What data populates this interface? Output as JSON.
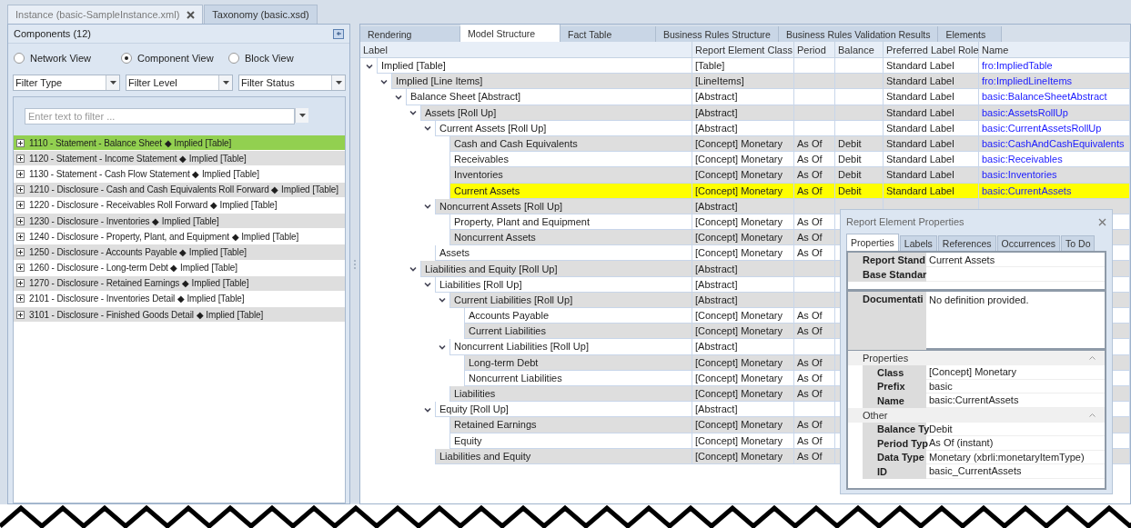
{
  "document_tabs": [
    {
      "label": "Instance (basic-SampleInstance.xml)",
      "selected": true,
      "closable": true
    },
    {
      "label": "Taxonomy (basic.xsd)",
      "selected": false,
      "closable": false
    }
  ],
  "components_panel": {
    "title": "Components (12)",
    "views": [
      {
        "label": "Network View",
        "selected": false
      },
      {
        "label": "Component View",
        "selected": true
      },
      {
        "label": "Block View",
        "selected": false
      }
    ],
    "filters": [
      {
        "value": "Filter Type"
      },
      {
        "value": "Filter Level"
      },
      {
        "value": "Filter Status"
      }
    ],
    "search": {
      "placeholder": "Enter text to filter ..."
    },
    "items": [
      {
        "label": "1110 - Statement - Balance Sheet ◆ Implied [Table]",
        "selected": true
      },
      {
        "label": "1120 - Statement - Income Statement ◆ Implied [Table]",
        "selected": false
      },
      {
        "label": "1130 - Statement - Cash Flow Statement ◆ Implied [Table]",
        "selected": false
      },
      {
        "label": "1210 - Disclosure - Cash and Cash Equivalents Roll Forward ◆ Implied [Table]",
        "selected": false
      },
      {
        "label": "1220 - Disclosure - Receivables Roll Forward ◆ Implied [Table]",
        "selected": false
      },
      {
        "label": "1230 - Disclosure - Inventories ◆ Implied [Table]",
        "selected": false
      },
      {
        "label": "1240 - Disclosure - Property, Plant, and Equipment ◆ Implied [Table]",
        "selected": false
      },
      {
        "label": "1250 - Disclosure - Accounts Payable ◆ Implied [Table]",
        "selected": false
      },
      {
        "label": "1260 - Disclosure - Long-term Debt ◆ Implied [Table]",
        "selected": false
      },
      {
        "label": "1270 - Disclosure - Retained Earnings ◆ Implied [Table]",
        "selected": false
      },
      {
        "label": "2101 - Disclosure - Inventories Detail ◆ Implied [Table]",
        "selected": false
      },
      {
        "label": "3101 - Disclosure - Finished Goods Detail ◆ Implied [Table]",
        "selected": false
      }
    ]
  },
  "view_tabs": [
    {
      "label": "Rendering",
      "selected": false
    },
    {
      "label": "Model Structure",
      "selected": true
    },
    {
      "label": "Fact Table",
      "selected": false
    },
    {
      "label": "Business Rules Structure",
      "selected": false
    },
    {
      "label": "Business Rules Validation Results",
      "selected": false
    },
    {
      "label": "Elements",
      "selected": false
    }
  ],
  "table": {
    "columns": [
      "Label",
      "Report Element Class",
      "Period",
      "Balance",
      "Preferred Label Role",
      "Name"
    ],
    "rows": [
      {
        "label": "Implied [Table]",
        "class": "[Table]",
        "role": "Standard Label",
        "name": "fro:ImpliedTable",
        "selected": false,
        "expanded": true,
        "children": [
          {
            "label": "Implied [Line Items]",
            "class": "[LineItems]",
            "role": "Standard Label",
            "name": "fro:ImpliedLineItems",
            "selected": false,
            "expanded": true,
            "children": [
              {
                "label": "Balance Sheet [Abstract]",
                "class": "[Abstract]",
                "role": "Standard Label",
                "name": "basic:BalanceSheetAbstract",
                "selected": false,
                "expanded": true,
                "children": [
                  {
                    "label": "Assets [Roll Up]",
                    "class": "[Abstract]",
                    "role": "Standard Label",
                    "name": "basic:AssetsRollUp",
                    "selected": false,
                    "expanded": true,
                    "children": [
                      {
                        "label": "Current Assets [Roll Up]",
                        "class": "[Abstract]",
                        "role": "Standard Label",
                        "name": "basic:CurrentAssetsRollUp",
                        "selected": false,
                        "expanded": true,
                        "children": [
                          {
                            "label": "Cash and Cash Equivalents",
                            "class": "[Concept] Monetary",
                            "period": "As Of",
                            "balance": "Debit",
                            "role": "Standard Label",
                            "name": "basic:CashAndCashEquivalents",
                            "selected": false
                          },
                          {
                            "label": "Receivables",
                            "class": "[Concept] Monetary",
                            "period": "As Of",
                            "balance": "Debit",
                            "role": "Standard Label",
                            "name": "basic:Receivables",
                            "selected": false
                          },
                          {
                            "label": "Inventories",
                            "class": "[Concept] Monetary",
                            "period": "As Of",
                            "balance": "Debit",
                            "role": "Standard Label",
                            "name": "basic:Inventories",
                            "selected": false
                          },
                          {
                            "label": "Current Assets",
                            "class": "[Concept] Monetary",
                            "period": "As Of",
                            "balance": "Debit",
                            "role": "Standard Label",
                            "name": "basic:CurrentAssets",
                            "selected": true
                          }
                        ]
                      },
                      {
                        "label": "Noncurrent Assets [Roll Up]",
                        "class": "[Abstract]",
                        "selected": false,
                        "expanded": true,
                        "children": [
                          {
                            "label": "Property, Plant and Equipment",
                            "class": "[Concept] Monetary",
                            "period": "As Of",
                            "selected": false
                          },
                          {
                            "label": "Noncurrent Assets",
                            "class": "[Concept] Monetary",
                            "period": "As Of",
                            "selected": false
                          }
                        ]
                      },
                      {
                        "label": "Assets",
                        "class": "[Concept] Monetary",
                        "period": "As Of",
                        "selected": false
                      }
                    ]
                  },
                  {
                    "label": "Liabilities and Equity [Roll Up]",
                    "class": "[Abstract]",
                    "selected": false,
                    "expanded": true,
                    "children": [
                      {
                        "label": "Liabilities [Roll Up]",
                        "class": "[Abstract]",
                        "selected": false,
                        "expanded": true,
                        "children": [
                          {
                            "label": "Current Liabilities [Roll Up]",
                            "class": "[Abstract]",
                            "selected": false,
                            "expanded": true,
                            "children": [
                              {
                                "label": "Accounts Payable",
                                "class": "[Concept] Monetary",
                                "period": "As Of",
                                "selected": false
                              },
                              {
                                "label": "Current Liabilities",
                                "class": "[Concept] Monetary",
                                "period": "As Of",
                                "selected": false
                              }
                            ]
                          },
                          {
                            "label": "Noncurrent Liabilities [Roll Up]",
                            "class": "[Abstract]",
                            "selected": false,
                            "expanded": true,
                            "children": [
                              {
                                "label": "Long-term Debt",
                                "class": "[Concept] Monetary",
                                "period": "As Of",
                                "selected": false
                              },
                              {
                                "label": "Noncurrent Liabilities",
                                "class": "[Concept] Monetary",
                                "period": "As Of",
                                "selected": false
                              }
                            ]
                          },
                          {
                            "label": "Liabilities",
                            "class": "[Concept] Monetary",
                            "period": "As Of",
                            "selected": false
                          }
                        ]
                      },
                      {
                        "label": "Equity [Roll Up]",
                        "class": "[Abstract]",
                        "selected": false,
                        "expanded": true,
                        "children": [
                          {
                            "label": "Retained Earnings",
                            "class": "[Concept] Monetary",
                            "period": "As Of",
                            "selected": false
                          },
                          {
                            "label": "Equity",
                            "class": "[Concept] Monetary",
                            "period": "As Of",
                            "selected": false
                          }
                        ]
                      },
                      {
                        "label": "Liabilities and Equity",
                        "class": "[Concept] Monetary",
                        "period": "As Of",
                        "selected": false
                      }
                    ]
                  }
                ]
              }
            ]
          }
        ]
      }
    ]
  },
  "properties_window": {
    "title": "Report Element Properties",
    "tabs": [
      {
        "label": "Properties",
        "selected": true
      },
      {
        "label": "Labels",
        "selected": false
      },
      {
        "label": "References",
        "selected": false
      },
      {
        "label": "Occurrences",
        "selected": false
      },
      {
        "label": "To Do",
        "selected": false
      }
    ],
    "fields": [
      {
        "label": "Report Stand",
        "value": "Current Assets"
      },
      {
        "label": "Base Standar"
      }
    ],
    "documentation": {
      "label": "Documentati",
      "value": "No definition provided."
    },
    "groups": [
      {
        "title": "Properties",
        "expanded": true,
        "fields": [
          {
            "label": "Class",
            "value": "[Concept] Monetary"
          },
          {
            "label": "Prefix",
            "value": "basic"
          },
          {
            "label": "Name",
            "value": "basic:CurrentAssets"
          }
        ]
      },
      {
        "title": "Other",
        "expanded": true,
        "fields": [
          {
            "label": "Balance Ty",
            "value": "Debit"
          },
          {
            "label": "Period Typ",
            "value": "As Of (instant)"
          },
          {
            "label": "Data Type",
            "value": "Monetary (xbrli:monetaryItemType)"
          },
          {
            "label": "ID",
            "value": "basic_CurrentAssets"
          }
        ]
      }
    ]
  }
}
